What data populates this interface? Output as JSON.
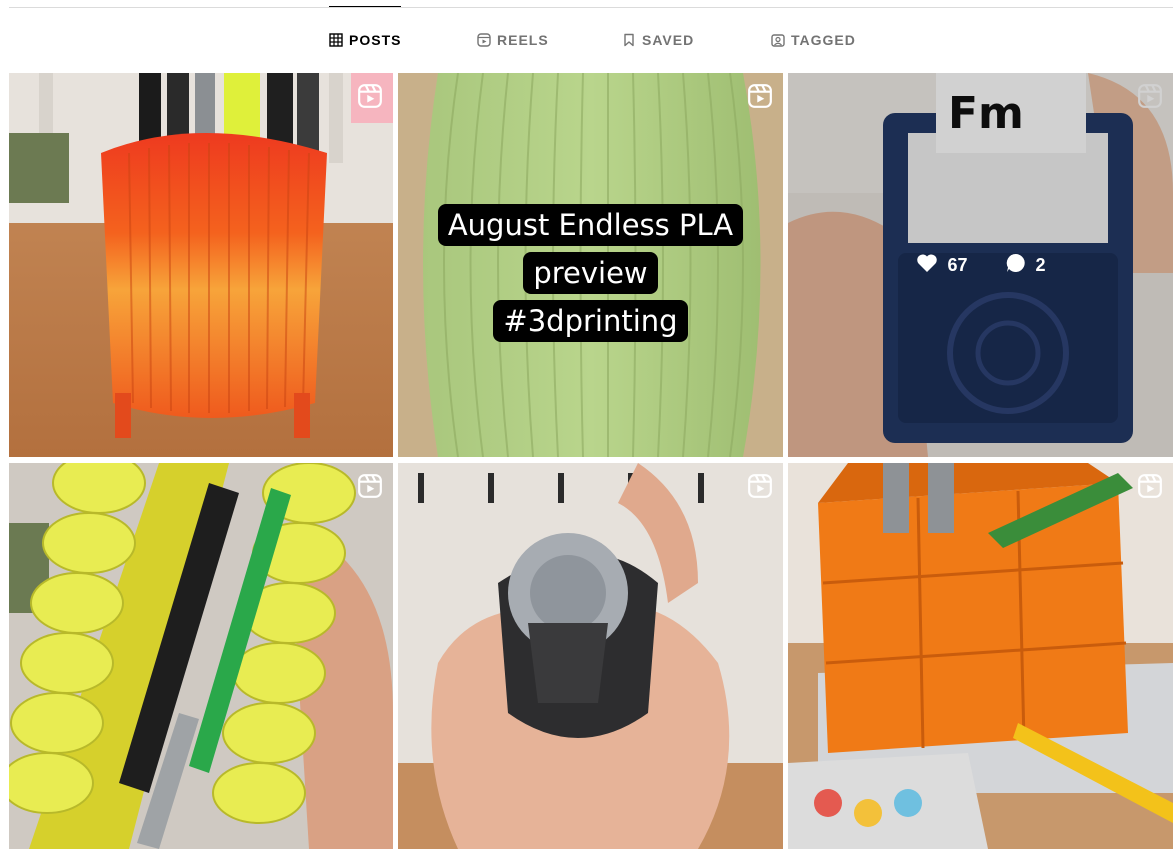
{
  "tabs": [
    {
      "label": "POSTS",
      "icon": "grid-icon",
      "active": true
    },
    {
      "label": "REELS",
      "icon": "reels-icon",
      "active": false
    },
    {
      "label": "SAVED",
      "icon": "bookmark-icon",
      "active": false
    },
    {
      "label": "TAGGED",
      "icon": "tagged-icon",
      "active": false
    }
  ],
  "posts": [
    {
      "type": "reel",
      "subject": "orange-pen-holder"
    },
    {
      "type": "reel",
      "subject": "green-filament-spool",
      "caption_lines": [
        "August Endless PLA",
        "preview",
        "#3dprinting"
      ]
    },
    {
      "type": "reel",
      "subject": "blue-card-box",
      "hovered": true,
      "likes": "67",
      "comments": "2"
    },
    {
      "type": "reel",
      "subject": "yellow-pen-tray"
    },
    {
      "type": "reel",
      "subject": "dial-keychain"
    },
    {
      "type": "reel",
      "subject": "orange-desk-organizer"
    }
  ],
  "colors": {
    "active_tab": "#000000",
    "inactive_tab": "#737373",
    "divider": "#dbdbdb"
  }
}
